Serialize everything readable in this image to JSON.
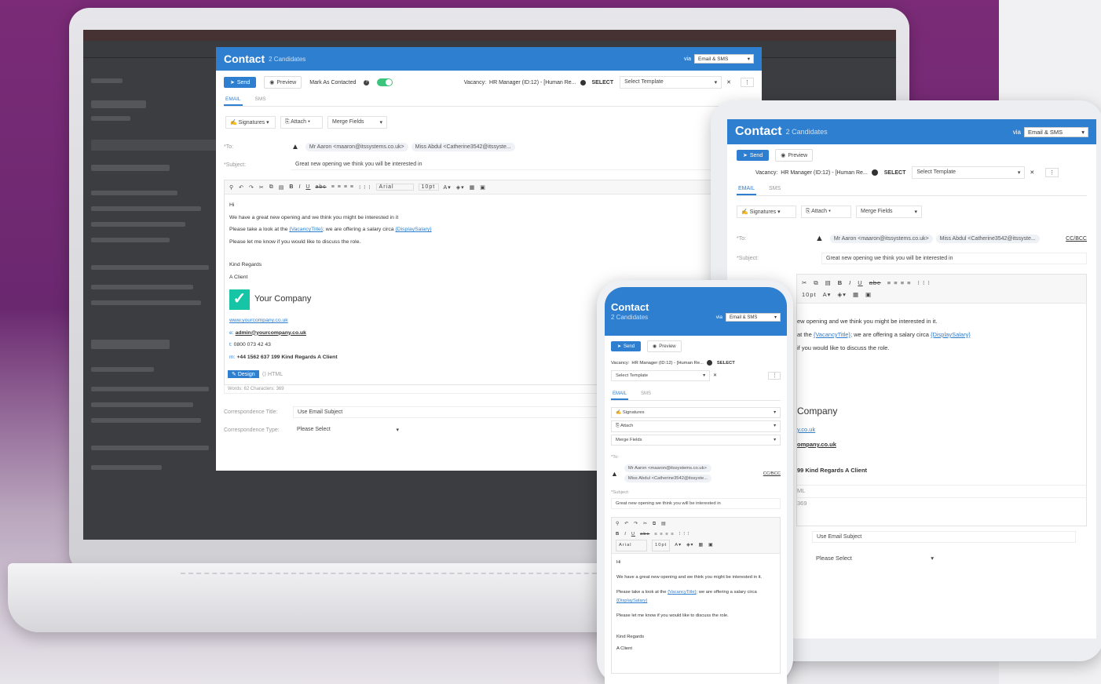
{
  "laptop": {
    "title": "Contact",
    "subtitle": "2 Candidates",
    "via_label": "via",
    "via_value": "Email & SMS",
    "send": "Send",
    "preview": "Preview",
    "mark_contacted": "Mark As Contacted",
    "vacancy_label": "Vacancy:",
    "vacancy_value": "HR Manager (ID:12) - [Human Re...",
    "select_label": "SELECT",
    "template_placeholder": "Select Template",
    "tab_email": "EMAIL",
    "tab_sms": "SMS",
    "signatures": "Signatures",
    "attach": "Attach",
    "merge_fields": "Merge Fields",
    "to_label": "*To:",
    "recipient1": "Mr Aaron <maaron@itssystems.co.uk>",
    "recipient2": "Miss Abdul <Catherine3542@itssyste...",
    "subject_label": "*Subject:",
    "subject_value": "Great new opening we think you will be interested in",
    "font_name": "Arial",
    "font_size": "10pt",
    "body_hi": "Hi",
    "body_line1": "We have a great new opening and we think you might be interested in it",
    "body_line2_pre": "Please take a look at the ",
    "body_vacancy_title": "{VacancyTitle}",
    "body_line2_mid": "; we are offering a salary circa ",
    "body_display_salary": "{DisplaySalary}",
    "body_line3": "Please let me know if you would like to discuss the role.",
    "body_regards": "Kind Regards",
    "body_client": "A Client",
    "company_name": "Your Company",
    "company_url": "www.yourcompany.co.uk",
    "email_prefix": "e:",
    "company_email": "admin@yourcompany.co.uk",
    "phone_prefix": "t:",
    "company_phone": "0800 073 42 43",
    "mobile_prefix": "m:",
    "company_mobile": "+44 1562 637 199 Kind Regards A Client",
    "design_tab": "Design",
    "html_tab": "HTML",
    "word_count": "Words: 62   Characters: 369",
    "corr_title_label": "Correspondence Title:",
    "corr_title_placeholder": "Use Email Subject",
    "corr_type_label": "Correspondence Type:",
    "corr_type_value": "Please Select"
  },
  "tablet": {
    "title": "Contact",
    "subtitle": "2 Candidates",
    "via_label": "via",
    "via_value": "Email & SMS",
    "send": "Send",
    "preview": "Preview",
    "vacancy_label": "Vacancy:",
    "vacancy_value": "HR Manager (ID:12) - [Human Re...",
    "select_label": "SELECT",
    "template_placeholder": "Select Template",
    "tab_email": "EMAIL",
    "tab_sms": "SMS",
    "signatures": "Signatures",
    "attach": "Attach",
    "merge_fields": "Merge Fields",
    "to_label": "*To:",
    "recipient1": "Mr Aaron <maaron@itssystems.co.uk>",
    "recipient2": "Miss Abdul <Catherine3542@itssyste...",
    "cc_bcc": "CC/BCC",
    "subject_label": "*Subject:",
    "subject_value": "Great new opening we think you will be interested in",
    "font_size": "10pt",
    "body_line1": "ew opening and we think you might be interested in it.",
    "body_line2_pre": "at the ",
    "body_vacancy_title": "{VacancyTitle}",
    "body_line2_mid": "; we are offering a salary circa ",
    "body_display_salary": "{DisplaySalary}",
    "body_line3": "if you would like to discuss the role.",
    "company_name": "Company",
    "company_url": "y.co.uk",
    "company_email": "ompany.co.uk",
    "company_mobile": "99 Kind Regards A Client",
    "html_tab": "ML",
    "char_count": "369",
    "corr_title_placeholder": "Use Email Subject",
    "corr_type_value": "Please Select"
  },
  "phone": {
    "title": "Contact",
    "subtitle": "2 Candidates",
    "via_label": "via",
    "via_value": "Email & SMS",
    "send": "Send",
    "preview": "Preview",
    "vacancy_label": "Vacancy:",
    "vacancy_value": "HR Manager (ID:12) - [Human Re...",
    "select_label": "SELECT",
    "template_placeholder": "Select Template",
    "tab_email": "EMAIL",
    "tab_sms": "SMS",
    "signatures": "Signatures",
    "attach": "Attach",
    "merge_fields": "Merge Fields",
    "to_label": "*To:",
    "recipient1": "Mr Aaron <maaron@itssystems.co.uk>",
    "recipient2": "Miss Abdul <Catherine3542@itssyste...",
    "cc_bcc": "CC/BCC",
    "subject_label": "*Subject:",
    "subject_value": "Great new opening we think you will be interested in",
    "font_name": "Arial",
    "font_size": "10pt",
    "body_hi": "Hi",
    "body_line1": "We have a great new opening and we think you might be interested in it.",
    "body_line2_pre": "Please take a look at the ",
    "body_vacancy_title": "{VacancyTitle}",
    "body_line2_mid": "; we are offering a salary circa ",
    "body_display_salary": "{DisplaySalary}",
    "body_line3": "Please let me know if you would like to discuss the role.",
    "body_regards": "Kind Regards",
    "body_client": "A Client"
  },
  "colors": {
    "accent": "#2f7fd0",
    "toggle": "#3cc47c",
    "check": "#16c5a5"
  }
}
